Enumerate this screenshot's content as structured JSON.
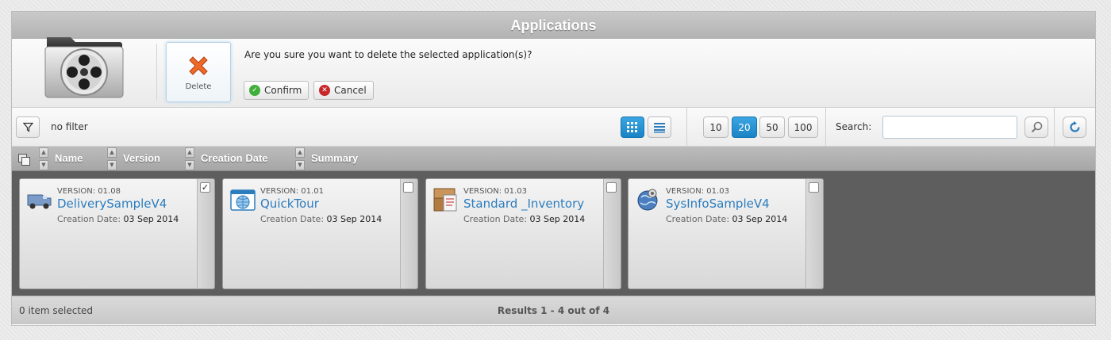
{
  "window": {
    "title": "Applications"
  },
  "header": {
    "delete_label": "Delete",
    "confirm_message": "Are you sure you want to delete the selected application(s)?",
    "confirm_label": "Confirm",
    "cancel_label": "Cancel"
  },
  "toolbar": {
    "filter_text": "no filter",
    "page_sizes": [
      "10",
      "20",
      "50",
      "100"
    ],
    "active_page_size": "20",
    "search_label": "Search:",
    "search_value": ""
  },
  "columns": [
    "Name",
    "Version",
    "Creation Date",
    "Summary"
  ],
  "cards": [
    {
      "version": "VERSION: 01.08",
      "name": "DeliverySampleV4",
      "date_label": "Creation Date:",
      "date": "03 Sep 2014",
      "icon": "delivery-truck-icon",
      "checked": true
    },
    {
      "version": "VERSION: 01.01",
      "name": "QuickTour",
      "date_label": "Creation Date:",
      "date": "03 Sep 2014",
      "icon": "browser-globe-icon",
      "checked": false
    },
    {
      "version": "VERSION: 01.03",
      "name": "Standard _Inventory",
      "date_label": "Creation Date:",
      "date": "03 Sep 2014",
      "icon": "inventory-boxes-icon",
      "checked": false
    },
    {
      "version": "VERSION: 01.03",
      "name": "SysInfoSampleV4",
      "date_label": "Creation Date:",
      "date": "03 Sep 2014",
      "icon": "sysinfo-globe-icon",
      "checked": false
    }
  ],
  "footer": {
    "selected_text": "0 item selected",
    "results_text": "Results 1 - 4 out of 4"
  },
  "colors": {
    "accent": "#2c7dbe",
    "active_button": "#1a83c5",
    "delete": "#e8581e",
    "confirm": "#3fae3b",
    "cancel": "#c6282b"
  }
}
